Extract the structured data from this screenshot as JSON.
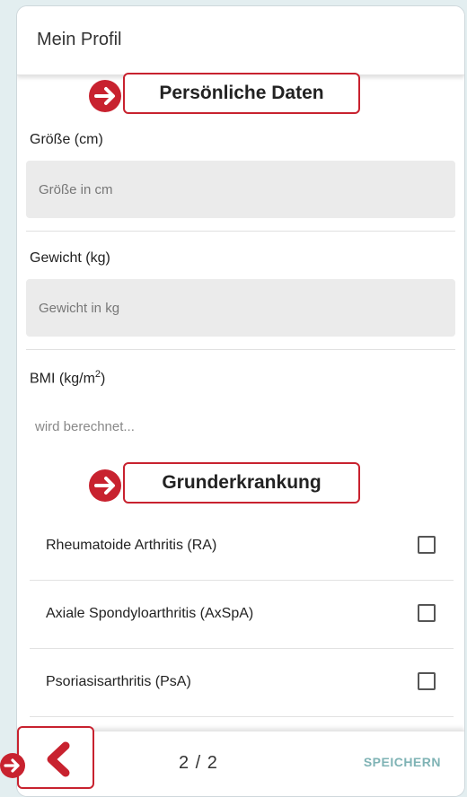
{
  "header": {
    "title": "Mein Profil"
  },
  "sections": {
    "personal": "Persönliche Daten",
    "disease": "Grunderkrankung"
  },
  "fields": {
    "height": {
      "label": "Größe (cm)",
      "placeholder": "Größe in cm"
    },
    "weight": {
      "label": "Gewicht (kg)",
      "placeholder": "Gewicht in kg"
    },
    "bmi": {
      "label_main": "BMI (kg/m",
      "label_sup": "2",
      "label_end": ")",
      "value": "wird berechnet..."
    }
  },
  "diseases": [
    {
      "label": "Rheumatoide Arthritis (RA)",
      "checked": false
    },
    {
      "label": "Axiale Spondyloarthritis (AxSpA)",
      "checked": false
    },
    {
      "label": "Psoriasisarthritis (PsA)",
      "checked": false
    }
  ],
  "footer": {
    "page": "2 / 2",
    "save": "SPEICHERN"
  },
  "colors": {
    "accent": "#c8222f",
    "save": "#7fb3b5",
    "background": "#e3eef0"
  },
  "icons": {
    "back": "chevron-left-icon",
    "pointer": "arrow-right-icon"
  }
}
